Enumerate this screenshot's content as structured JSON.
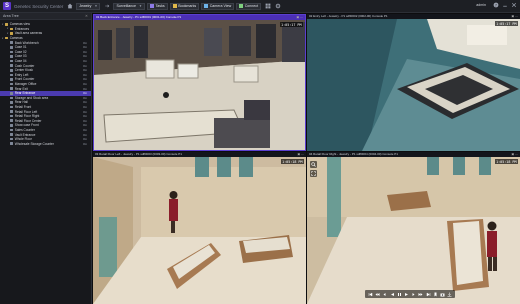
{
  "toolbar": {
    "app_name": "Genetec Security Center",
    "site_select": "Jewelry",
    "layout_select": "Surveillance",
    "buttons": [
      {
        "label": "Tasks"
      },
      {
        "label": "Bookmarks"
      },
      {
        "label": "Camera View"
      },
      {
        "label": "Connect"
      }
    ],
    "user": "admin"
  },
  "sidebar": {
    "title": "Area Tree",
    "items": [
      {
        "label": "Cameras view",
        "level": 0,
        "type": "folder",
        "status": ""
      },
      {
        "label": "Entrances",
        "level": 1,
        "type": "folder",
        "status": ""
      },
      {
        "label": "Vault area cameras",
        "level": 1,
        "type": "folder",
        "status": ""
      },
      {
        "label": "Cameras",
        "level": 0,
        "type": "folder",
        "status": ""
      },
      {
        "label": "Back Workbench",
        "level": 1,
        "type": "camera",
        "status": "On"
      },
      {
        "label": "Case 01",
        "level": 1,
        "type": "camera",
        "status": "On"
      },
      {
        "label": "Case 02",
        "level": 1,
        "type": "camera",
        "status": "On"
      },
      {
        "label": "Case 03",
        "level": 1,
        "type": "camera",
        "status": "On"
      },
      {
        "label": "Case 04",
        "level": 1,
        "type": "camera",
        "status": "On"
      },
      {
        "label": "Cash Counter",
        "level": 1,
        "type": "camera",
        "status": "On"
      },
      {
        "label": "Center Kiosk",
        "level": 1,
        "type": "camera",
        "status": "On"
      },
      {
        "label": "Entry Left",
        "level": 1,
        "type": "camera",
        "status": "On"
      },
      {
        "label": "Front Counter",
        "level": 1,
        "type": "camera",
        "status": "On"
      },
      {
        "label": "Manager Office",
        "level": 1,
        "type": "camera",
        "status": "On"
      },
      {
        "label": "Rear Exit",
        "level": 1,
        "type": "camera",
        "status": "On"
      },
      {
        "label": "Rear Entrance",
        "level": 1,
        "type": "camera",
        "status": "On",
        "selected": true
      },
      {
        "label": "Storage and Stock area",
        "level": 1,
        "type": "camera",
        "status": "On"
      },
      {
        "label": "Rear Hall",
        "level": 1,
        "type": "camera",
        "status": "On"
      },
      {
        "label": "Retail Front",
        "level": 1,
        "type": "camera",
        "status": "On"
      },
      {
        "label": "Retail Floor Left",
        "level": 1,
        "type": "camera",
        "status": "On"
      },
      {
        "label": "Retail Floor Right",
        "level": 1,
        "type": "camera",
        "status": "On"
      },
      {
        "label": "Retail Floor Center",
        "level": 1,
        "type": "camera",
        "status": "On"
      },
      {
        "label": "Show case Front",
        "level": 1,
        "type": "camera",
        "status": "On"
      },
      {
        "label": "Sales Counter",
        "level": 1,
        "type": "camera",
        "status": "On"
      },
      {
        "label": "Vault Entrance",
        "level": 1,
        "type": "camera",
        "status": "On"
      },
      {
        "label": "Whole Floor",
        "level": 1,
        "type": "camera",
        "status": "On"
      },
      {
        "label": "Wholesale Storage Counter",
        "level": 1,
        "type": "camera",
        "status": "On"
      }
    ]
  },
  "tiles": [
    {
      "title": "01 Back Entrance - Jewelry - P1 sdfl0001 (0001-00) Console P1",
      "timestamp": "1:05:17 PM",
      "active": true
    },
    {
      "title": "02 Entry Left - Jewelry - P1 sdfl0002 (0002-00) Console P1",
      "timestamp": "1:05:17 PM",
      "active": false
    },
    {
      "title": "03 Retail Floor Left - Jewelry - P1 sdfl0003 (0003-00) Console P1",
      "timestamp": "1:05:18 PM",
      "active": false
    },
    {
      "title": "04 Retail Floor Right - Jewelry - P1 sdfl0004 (0004-00) Console P1",
      "timestamp": "1:05:18 PM",
      "active": false
    }
  ],
  "colors": {
    "accent": "#4b2fb6",
    "selection": "#4b3bb0",
    "toolbar_bg": "#1d1f24",
    "sidebar_bg": "#17181c"
  }
}
